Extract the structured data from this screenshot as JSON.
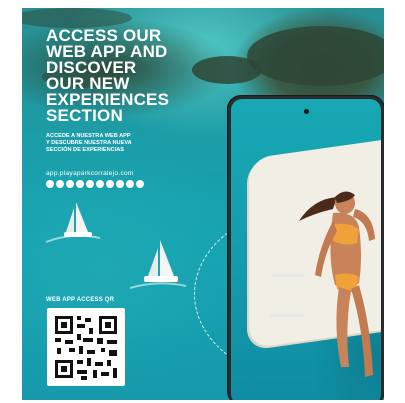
{
  "headline": {
    "line1": "ACCESS OUR",
    "line2": "WEB APP AND",
    "line3": "DISCOVER",
    "line4": "OUR NEW",
    "line5": "EXPERIENCES",
    "line6": "SECTION"
  },
  "subline": {
    "line1": "ACCEDE A NUESTRA WEB APP",
    "line2": "Y DESCUBRE NUESTRA NUEVA",
    "line3": "SECCIÓN DE EXPERIENCIAS"
  },
  "url": "app.playaparkcorralejo.com",
  "social_icons": [
    "youtube-icon",
    "instagram-icon",
    "facebook-icon",
    "tiktok-icon",
    "pinterest-icon",
    "tripadvisor-icon",
    "mail-icon",
    "more-icon",
    "whatsapp-icon",
    "link-icon"
  ],
  "qr": {
    "label": "WEB APP ACCESS QR"
  },
  "colors": {
    "sea": "#15a2b2",
    "text": "#ffffff",
    "phone_frame": "#2b2b2e",
    "bikini": "#f0a13a"
  }
}
